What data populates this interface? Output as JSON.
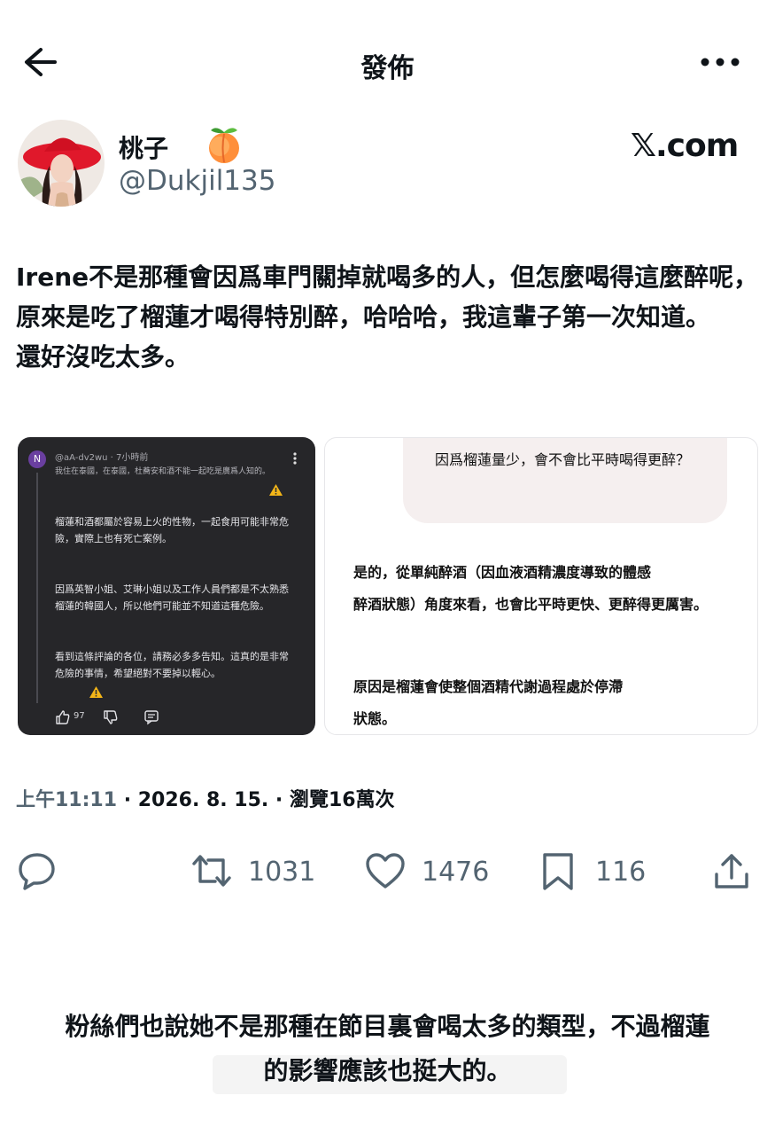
{
  "header": {
    "title": "發佈"
  },
  "author": {
    "name": "桃子",
    "emoji": "🍑",
    "handle": "@Dukjil135",
    "watermark": "𝕏.com"
  },
  "post": {
    "lines": [
      "Irene不是那種會因爲車門關掉就喝多的人，但怎麼喝得這麼醉呢，",
      "原來是吃了榴蓮才喝得特別醉，哈哈哈，我這輩子第一次知道。",
      "還好沒吃太多。"
    ]
  },
  "media_left": {
    "avatar_letter": "N",
    "meta": "@aA-dv2wu · 7小時前",
    "line1": "我住在泰國，在泰國，杜蕎安和酒不能一起吃是廣爲人知的。",
    "para1": "榴蓮和酒都屬於容易上火的性物，一起食用可能非常危險，實際上也有死亡案例。",
    "para2": "因爲英智小姐、艾琳小姐以及工作人員們都是不太熟悉榴蓮的韓國人，所以他們可能並不知道這種危險。",
    "para3": "看到這條評論的各位，請務必多多告知。這真的是非常危險的事情，希望絕對不要掉以輕心。",
    "likes": "97"
  },
  "media_right": {
    "question": "因爲榴蓮量少，會不會比平時喝得更醉？",
    "answer1_line1": "是的，從單純醉酒（因血液酒精濃度導致的體感",
    "answer1_line2": "醉酒狀態）角度來看，也會比平時更快、更醉得更厲害。",
    "answer2_line1": "原因是榴蓮會使整個酒精代謝過程處於停滯",
    "answer2_line2": "狀態。"
  },
  "meta": {
    "time": "上午11:11",
    "date": " · 2026. 8. 15. · ",
    "views": "瀏覽16萬次"
  },
  "stats": {
    "retweets": "1031",
    "likes": "1476",
    "bookmarks": "116"
  },
  "caption": {
    "line1": "粉絲們也說她不是那種在節目裏會喝太多的類型，不過榴蓮",
    "line2": "的影響應該也挺大的。"
  }
}
